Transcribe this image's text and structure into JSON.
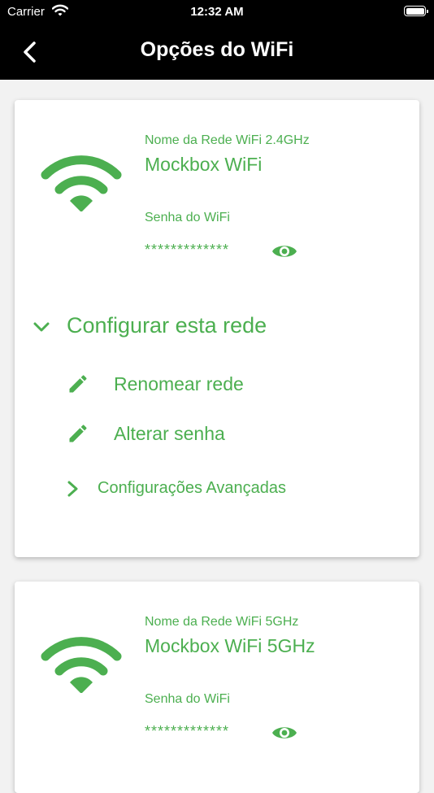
{
  "status_bar": {
    "carrier": "Carrier",
    "time": "12:32 AM"
  },
  "header": {
    "title": "Opções do WiFi",
    "back_icon": "chevron-left-icon"
  },
  "colors": {
    "accent": "#4caf50",
    "nav_background": "#000000",
    "page_background": "#f2f2f2"
  },
  "networks": [
    {
      "name_label": "Nome da Rede WiFi 2.4GHz",
      "name": "Mockbox WiFi",
      "password_label": "Senha do WiFi",
      "password": "*************",
      "configure": {
        "label": "Configurar esta rede",
        "actions": [
          "Renomear rede",
          "Alterar senha"
        ],
        "advanced": "Configurações Avançadas"
      }
    },
    {
      "name_label": "Nome da Rede WiFi 5GHz",
      "name": "Mockbox WiFi 5GHz",
      "password_label": "Senha do WiFi",
      "password": "*************"
    }
  ]
}
